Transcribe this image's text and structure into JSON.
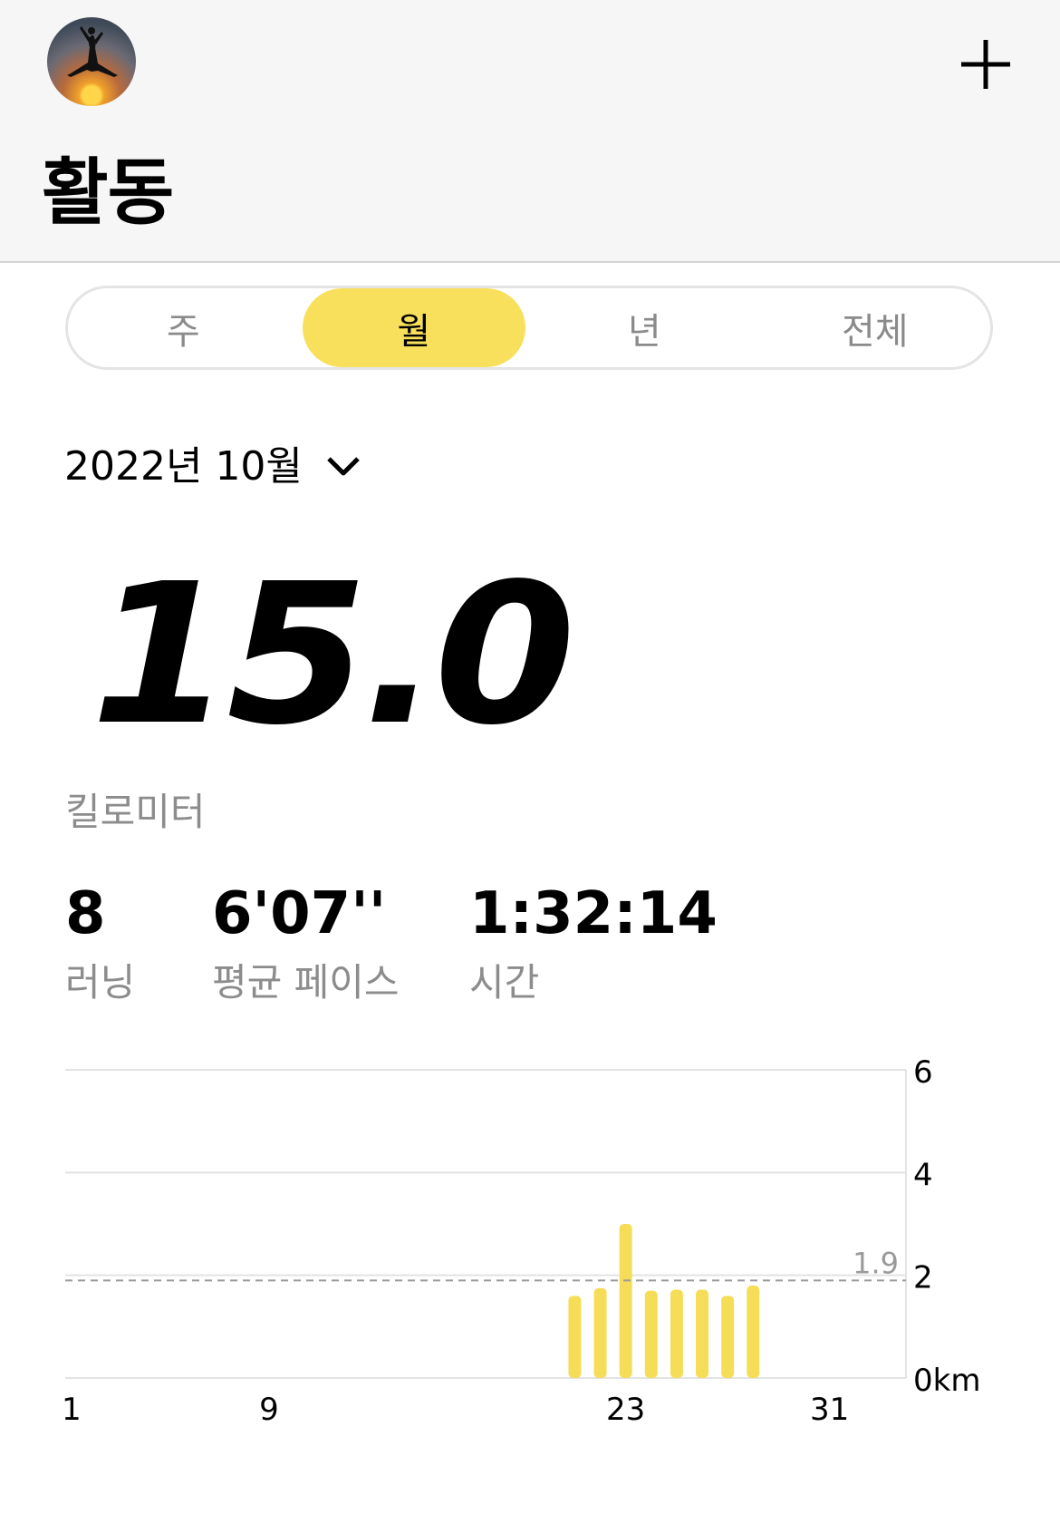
{
  "header": {
    "title": "활동",
    "avatar_icon": "profile-photo",
    "add_icon": "plus-icon"
  },
  "tabs": [
    {
      "label": "주",
      "active": false
    },
    {
      "label": "월",
      "active": true
    },
    {
      "label": "년",
      "active": false
    },
    {
      "label": "전체",
      "active": false
    }
  ],
  "period": {
    "label": "2022년 10월",
    "icon": "chevron-down-icon"
  },
  "summary": {
    "distance": "15.0",
    "distance_unit": "킬로미터",
    "runs_value": "8",
    "runs_label": "러닝",
    "pace_value": "6'07''",
    "pace_label": "평균 페이스",
    "time_value": "1:32:14",
    "time_label": "시간"
  },
  "colors": {
    "accent": "#f8e05c",
    "bar": "#f6dd58",
    "muted_text": "#8c8c8c"
  },
  "chart_data": {
    "type": "bar",
    "x": [
      21,
      22,
      23,
      24,
      25,
      26,
      27,
      28
    ],
    "values": [
      1.6,
      1.75,
      3.0,
      1.7,
      1.72,
      1.72,
      1.6,
      1.8
    ],
    "x_ticks": [
      "1",
      "9",
      "23",
      "31"
    ],
    "x_range": [
      1,
      34
    ],
    "y_ticks": [
      "0km",
      "2",
      "4",
      "6"
    ],
    "ylim": [
      0,
      6
    ],
    "average_line": {
      "value": 1.9,
      "label": "1.9"
    },
    "grid": true
  }
}
